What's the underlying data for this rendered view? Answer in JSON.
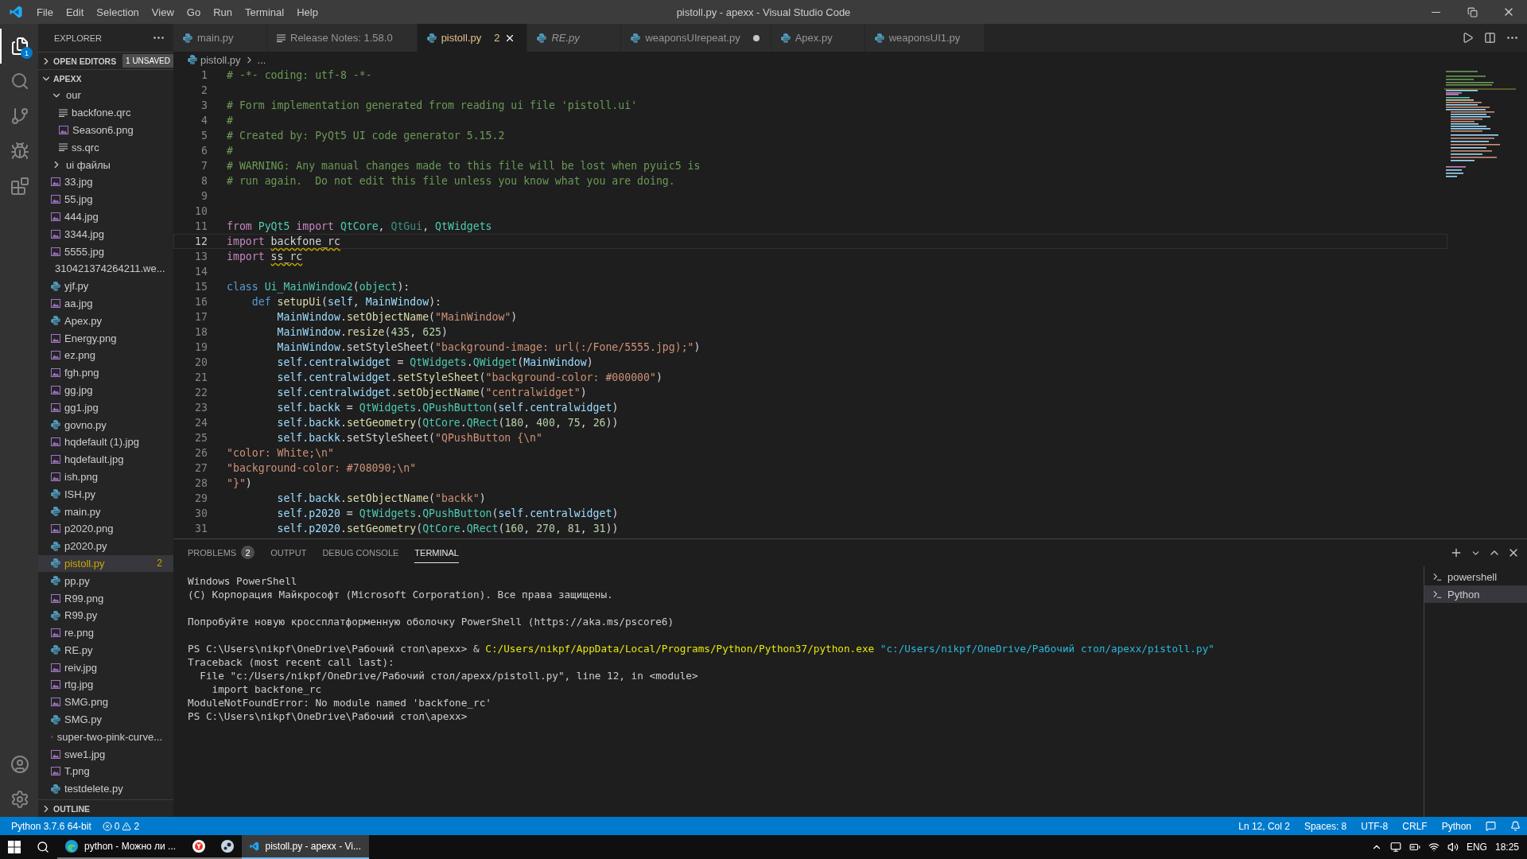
{
  "title_bar": {
    "menus": [
      "File",
      "Edit",
      "Selection",
      "View",
      "Go",
      "Run",
      "Terminal",
      "Help"
    ],
    "title": "pistoll.py - apexx - Visual Studio Code"
  },
  "activity_bar": {
    "explorer_badge": "1"
  },
  "explorer": {
    "title": "EXPLORER",
    "open_editors": {
      "label": "OPEN EDITORS",
      "badge": "1 UNSAVED",
      "expanded": false
    },
    "root": {
      "label": "APEXX",
      "expanded": true,
      "children": [
        {
          "label": "our",
          "kind": "folder",
          "expanded": true,
          "selected": false,
          "children": [
            {
              "label": "backfone.qrc",
              "kind": "resource",
              "selected": false
            },
            {
              "label": "Season6.png",
              "kind": "image",
              "selected": false
            },
            {
              "label": "ss.qrc",
              "kind": "resource",
              "selected": false
            }
          ]
        },
        {
          "label": "ui файлы",
          "kind": "folder",
          "expanded": false,
          "selected": false
        },
        {
          "label": "33.jpg",
          "kind": "image",
          "selected": false
        },
        {
          "label": "55.jpg",
          "kind": "image",
          "selected": false
        },
        {
          "label": "444.jpg",
          "kind": "image",
          "selected": false
        },
        {
          "label": "3344.jpg",
          "kind": "image",
          "selected": false
        },
        {
          "label": "5555.jpg",
          "kind": "image",
          "selected": false
        },
        {
          "label": "310421374264211.we...",
          "kind": "image",
          "selected": false
        },
        {
          "label": "yjf.py",
          "kind": "python",
          "selected": false
        },
        {
          "label": "aa.jpg",
          "kind": "image",
          "selected": false
        },
        {
          "label": "Apex.py",
          "kind": "python",
          "selected": false
        },
        {
          "label": "Energy.png",
          "kind": "image",
          "selected": false
        },
        {
          "label": "ez.png",
          "kind": "image",
          "selected": false
        },
        {
          "label": "fgh.png",
          "kind": "image",
          "selected": false
        },
        {
          "label": "gg.jpg",
          "kind": "image",
          "selected": false
        },
        {
          "label": "gg1.jpg",
          "kind": "image",
          "selected": false
        },
        {
          "label": "govno.py",
          "kind": "python",
          "selected": false
        },
        {
          "label": "hqdefault (1).jpg",
          "kind": "image",
          "selected": false
        },
        {
          "label": "hqdefault.jpg",
          "kind": "image",
          "selected": false
        },
        {
          "label": "ish.png",
          "kind": "image",
          "selected": false
        },
        {
          "label": "ISH.py",
          "kind": "python",
          "selected": false
        },
        {
          "label": "main.py",
          "kind": "python",
          "selected": false
        },
        {
          "label": "p2020.png",
          "kind": "image",
          "selected": false
        },
        {
          "label": "p2020.py",
          "kind": "python",
          "selected": false
        },
        {
          "label": "pistoll.py",
          "kind": "python",
          "selected": true,
          "badge": "2"
        },
        {
          "label": "pp.py",
          "kind": "python",
          "selected": false
        },
        {
          "label": "R99.png",
          "kind": "image",
          "selected": false
        },
        {
          "label": "R99.py",
          "kind": "python",
          "selected": false
        },
        {
          "label": "re.png",
          "kind": "image",
          "selected": false
        },
        {
          "label": "RE.py",
          "kind": "python",
          "selected": false
        },
        {
          "label": "reiv.jpg",
          "kind": "image",
          "selected": false
        },
        {
          "label": "rtg.jpg",
          "kind": "image",
          "selected": false
        },
        {
          "label": "SMG.png",
          "kind": "image",
          "selected": false
        },
        {
          "label": "SMG.py",
          "kind": "python",
          "selected": false
        },
        {
          "label": "super-two-pink-curve...",
          "kind": "image",
          "selected": false
        },
        {
          "label": "swe1.jpg",
          "kind": "image",
          "selected": false
        },
        {
          "label": "T.png",
          "kind": "image",
          "selected": false
        },
        {
          "label": "testdelete.py",
          "kind": "python",
          "selected": false
        }
      ]
    },
    "outline": {
      "label": "OUTLINE",
      "expanded": false
    }
  },
  "tabs": [
    {
      "label": "main.py",
      "kind": "python",
      "selected": false,
      "preview": false,
      "dirty": false
    },
    {
      "label": "Release Notes: 1.58.0",
      "kind": "notes",
      "selected": false,
      "preview": false,
      "dirty": false
    },
    {
      "label": "pistoll.py",
      "kind": "python",
      "selected": true,
      "preview": false,
      "dirty": false,
      "badge": "2"
    },
    {
      "label": "RE.py",
      "kind": "python",
      "selected": false,
      "preview": true,
      "dirty": false
    },
    {
      "label": "weaponsUIrepeat.py",
      "kind": "python",
      "selected": false,
      "preview": false,
      "dirty": true
    },
    {
      "label": "Apex.py",
      "kind": "python",
      "selected": false,
      "preview": false,
      "dirty": false
    },
    {
      "label": "weaponsUI1.py",
      "kind": "python",
      "selected": false,
      "preview": false,
      "dirty": false
    }
  ],
  "breadcrumbs": [
    "pistoll.py",
    "..."
  ],
  "code": [
    {
      "number": "1",
      "current": false,
      "tokens": [
        {
          "kind": "cm",
          "text": "# -*- coding: utf-8 -*-"
        }
      ]
    },
    {
      "number": "2",
      "current": false
    },
    {
      "number": "3",
      "current": false,
      "tokens": [
        {
          "kind": "cm",
          "text": "# Form implementation generated from reading ui file 'pistoll.ui'"
        }
      ]
    },
    {
      "number": "4",
      "current": false,
      "tokens": [
        {
          "kind": "cm",
          "text": "#"
        }
      ]
    },
    {
      "number": "5",
      "current": false,
      "tokens": [
        {
          "kind": "cm",
          "text": "# Created by: PyQt5 UI code generator 5.15.2"
        }
      ]
    },
    {
      "number": "6",
      "current": false,
      "tokens": [
        {
          "kind": "cm",
          "text": "#"
        }
      ]
    },
    {
      "number": "7",
      "current": false,
      "tokens": [
        {
          "kind": "cm",
          "text": "# WARNING: Any manual changes made to this file will be lost when pyuic5 is"
        }
      ]
    },
    {
      "number": "8",
      "current": false,
      "tokens": [
        {
          "kind": "cm",
          "text": "# run again.  Do not edit this file unless you know what you are doing."
        }
      ]
    },
    {
      "number": "9",
      "current": false
    },
    {
      "number": "10",
      "current": false
    },
    {
      "number": "11",
      "current": false,
      "tokens": [
        {
          "kind": "kw",
          "text": "from "
        },
        {
          "kind": "cls",
          "text": "PyQt5"
        },
        {
          "kind": "kw",
          "text": " import "
        },
        {
          "kind": "cls",
          "text": "QtCore"
        },
        {
          "kind": "tx",
          "text": ", "
        },
        {
          "kind": "dim",
          "text": "QtGui"
        },
        {
          "kind": "tx",
          "text": ", "
        },
        {
          "kind": "cls",
          "text": "QtWidgets"
        }
      ]
    },
    {
      "number": "12",
      "current": true,
      "tokens": [
        {
          "kind": "kw",
          "text": "import "
        },
        {
          "kind": "warn",
          "text": "backfone_rc"
        }
      ]
    },
    {
      "number": "13",
      "current": false,
      "tokens": [
        {
          "kind": "kw",
          "text": "import "
        },
        {
          "kind": "warn",
          "text": "ss_rc"
        }
      ]
    },
    {
      "number": "14",
      "current": false
    },
    {
      "number": "15",
      "current": false,
      "tokens": [
        {
          "kind": "st",
          "text": "class "
        },
        {
          "kind": "cls",
          "text": "Ui_MainWindow2"
        },
        {
          "kind": "tx",
          "text": "("
        },
        {
          "kind": "cls",
          "text": "object"
        },
        {
          "kind": "tx",
          "text": "):"
        }
      ]
    },
    {
      "number": "16",
      "current": false,
      "tokens": [
        {
          "kind": "st",
          "text": "    def "
        },
        {
          "kind": "fn",
          "text": "setupUi"
        },
        {
          "kind": "tx",
          "text": "("
        },
        {
          "kind": "var",
          "text": "self"
        },
        {
          "kind": "tx",
          "text": ", "
        },
        {
          "kind": "var",
          "text": "MainWindow"
        },
        {
          "kind": "tx",
          "text": "):"
        }
      ]
    },
    {
      "number": "17",
      "current": false,
      "tokens": [
        {
          "kind": "var",
          "text": "        MainWindow"
        },
        {
          "kind": "tx",
          "text": "."
        },
        {
          "kind": "fn",
          "text": "setObjectName"
        },
        {
          "kind": "tx",
          "text": "("
        },
        {
          "kind": "str",
          "text": "\"MainWindow\""
        },
        {
          "kind": "tx",
          "text": ")"
        }
      ]
    },
    {
      "number": "18",
      "current": false,
      "tokens": [
        {
          "kind": "var",
          "text": "        MainWindow"
        },
        {
          "kind": "tx",
          "text": "."
        },
        {
          "kind": "fn",
          "text": "resize"
        },
        {
          "kind": "tx",
          "text": "("
        },
        {
          "kind": "num",
          "text": "435"
        },
        {
          "kind": "tx",
          "text": ", "
        },
        {
          "kind": "num",
          "text": "625"
        },
        {
          "kind": "tx",
          "text": ")"
        }
      ]
    },
    {
      "number": "19",
      "current": false,
      "tokens": [
        {
          "kind": "var",
          "text": "        MainWindow"
        },
        {
          "kind": "tx",
          "text": ".setStyleSheet("
        },
        {
          "kind": "str",
          "text": "\"background-image: url(:/Fone/5555.jpg);\""
        },
        {
          "kind": "tx",
          "text": ")"
        }
      ]
    },
    {
      "number": "20",
      "current": false,
      "tokens": [
        {
          "kind": "var",
          "text": "        self.centralwidget"
        },
        {
          "kind": "tx",
          "text": " = "
        },
        {
          "kind": "cls",
          "text": "QtWidgets"
        },
        {
          "kind": "tx",
          "text": "."
        },
        {
          "kind": "cls",
          "text": "QWidget"
        },
        {
          "kind": "tx",
          "text": "("
        },
        {
          "kind": "var",
          "text": "MainWindow"
        },
        {
          "kind": "tx",
          "text": ")"
        }
      ]
    },
    {
      "number": "21",
      "current": false,
      "tokens": [
        {
          "kind": "var",
          "text": "        self.centralwidget"
        },
        {
          "kind": "tx",
          "text": "."
        },
        {
          "kind": "fn",
          "text": "setStyleSheet"
        },
        {
          "kind": "tx",
          "text": "("
        },
        {
          "kind": "str",
          "text": "\"background-color: #000000\""
        },
        {
          "kind": "tx",
          "text": ")"
        }
      ]
    },
    {
      "number": "22",
      "current": false,
      "tokens": [
        {
          "kind": "var",
          "text": "        self.centralwidget"
        },
        {
          "kind": "tx",
          "text": "."
        },
        {
          "kind": "fn",
          "text": "setObjectName"
        },
        {
          "kind": "tx",
          "text": "("
        },
        {
          "kind": "str",
          "text": "\"centralwidget\""
        },
        {
          "kind": "tx",
          "text": ")"
        }
      ]
    },
    {
      "number": "23",
      "current": false,
      "tokens": [
        {
          "kind": "var",
          "text": "        self.backk"
        },
        {
          "kind": "tx",
          "text": " = "
        },
        {
          "kind": "cls",
          "text": "QtWidgets"
        },
        {
          "kind": "tx",
          "text": "."
        },
        {
          "kind": "cls",
          "text": "QPushButton"
        },
        {
          "kind": "tx",
          "text": "("
        },
        {
          "kind": "var",
          "text": "self.centralwidget"
        },
        {
          "kind": "tx",
          "text": ")"
        }
      ]
    },
    {
      "number": "24",
      "current": false,
      "tokens": [
        {
          "kind": "var",
          "text": "        self.backk"
        },
        {
          "kind": "tx",
          "text": "."
        },
        {
          "kind": "fn",
          "text": "setGeometry"
        },
        {
          "kind": "tx",
          "text": "("
        },
        {
          "kind": "cls",
          "text": "QtCore"
        },
        {
          "kind": "tx",
          "text": "."
        },
        {
          "kind": "cls",
          "text": "QRect"
        },
        {
          "kind": "tx",
          "text": "("
        },
        {
          "kind": "num",
          "text": "180"
        },
        {
          "kind": "tx",
          "text": ", "
        },
        {
          "kind": "num",
          "text": "400"
        },
        {
          "kind": "tx",
          "text": ", "
        },
        {
          "kind": "num",
          "text": "75"
        },
        {
          "kind": "tx",
          "text": ", "
        },
        {
          "kind": "num",
          "text": "26"
        },
        {
          "kind": "tx",
          "text": "))"
        }
      ]
    },
    {
      "number": "25",
      "current": false,
      "tokens": [
        {
          "kind": "var",
          "text": "        self.backk"
        },
        {
          "kind": "tx",
          "text": ".setStyleSheet("
        },
        {
          "kind": "str",
          "text": "\"QPushButton {\\n\""
        }
      ]
    },
    {
      "number": "26",
      "current": false,
      "tokens": [
        {
          "kind": "str",
          "text": "\"color: White;\\n\""
        }
      ]
    },
    {
      "number": "27",
      "current": false,
      "tokens": [
        {
          "kind": "str",
          "text": "\"background-color: #708090;\\n\""
        }
      ]
    },
    {
      "number": "28",
      "current": false,
      "tokens": [
        {
          "kind": "str",
          "text": "\"}\""
        },
        {
          "kind": "tx",
          "text": ")"
        }
      ]
    },
    {
      "number": "29",
      "current": false,
      "tokens": [
        {
          "kind": "var",
          "text": "        self.backk"
        },
        {
          "kind": "tx",
          "text": "."
        },
        {
          "kind": "fn",
          "text": "setObjectName"
        },
        {
          "kind": "tx",
          "text": "("
        },
        {
          "kind": "str",
          "text": "\"backk\""
        },
        {
          "kind": "tx",
          "text": ")"
        }
      ]
    },
    {
      "number": "30",
      "current": false,
      "tokens": [
        {
          "kind": "var",
          "text": "        self.p2020"
        },
        {
          "kind": "tx",
          "text": " = "
        },
        {
          "kind": "cls",
          "text": "QtWidgets"
        },
        {
          "kind": "tx",
          "text": "."
        },
        {
          "kind": "cls",
          "text": "QPushButton"
        },
        {
          "kind": "tx",
          "text": "("
        },
        {
          "kind": "var",
          "text": "self.centralwidget"
        },
        {
          "kind": "tx",
          "text": ")"
        }
      ]
    },
    {
      "number": "31",
      "current": false,
      "tokens": [
        {
          "kind": "var",
          "text": "        self.p2020"
        },
        {
          "kind": "tx",
          "text": "."
        },
        {
          "kind": "fn",
          "text": "setGeometry"
        },
        {
          "kind": "tx",
          "text": "("
        },
        {
          "kind": "cls",
          "text": "QtCore"
        },
        {
          "kind": "tx",
          "text": "."
        },
        {
          "kind": "cls",
          "text": "QRect"
        },
        {
          "kind": "tx",
          "text": "("
        },
        {
          "kind": "num",
          "text": "160"
        },
        {
          "kind": "tx",
          "text": ", "
        },
        {
          "kind": "num",
          "text": "270"
        },
        {
          "kind": "tx",
          "text": ", "
        },
        {
          "kind": "num",
          "text": "81"
        },
        {
          "kind": "tx",
          "text": ", "
        },
        {
          "kind": "num",
          "text": "31"
        },
        {
          "kind": "tx",
          "text": "))"
        }
      ]
    }
  ],
  "panel": {
    "tabs": [
      {
        "label": "PROBLEMS",
        "selected": false,
        "badge": "2"
      },
      {
        "label": "OUTPUT",
        "selected": false
      },
      {
        "label": "DEBUG CONSOLE",
        "selected": false
      },
      {
        "label": "TERMINAL",
        "selected": true
      }
    ],
    "terminal": [
      {
        "kind": "text",
        "segments": [
          {
            "kind": "plain",
            "text": "Windows PowerShell"
          }
        ]
      },
      {
        "kind": "text",
        "segments": [
          {
            "kind": "plain",
            "text": "(C) Корпорация Майкрософт (Microsoft Corporation). Все права защищены."
          }
        ]
      },
      {
        "kind": "blank"
      },
      {
        "kind": "text",
        "segments": [
          {
            "kind": "plain",
            "text": "Попробуйте новую кроссплатформенную оболочку PowerShell (https://aka.ms/pscore6)"
          }
        ]
      },
      {
        "kind": "blank"
      },
      {
        "kind": "text",
        "segments": [
          {
            "kind": "plain",
            "text": "PS C:\\Users\\nikpf\\OneDrive\\Рабочий стол\\apexx> & "
          },
          {
            "kind": "path",
            "text": "C:/Users/nikpf/AppData/Local/Programs/Python/Python37/python.exe"
          },
          {
            "kind": "string",
            "text": " \"c:/Users/nikpf/OneDrive/Рабочий стол/apexx/pistoll.py\""
          }
        ]
      },
      {
        "kind": "text",
        "segments": [
          {
            "kind": "plain",
            "text": "Traceback (most recent call last):"
          }
        ]
      },
      {
        "kind": "text",
        "segments": [
          {
            "kind": "plain",
            "text": "  File \"c:/Users/nikpf/OneDrive/Рабочий стол/apexx/pistoll.py\", line 12, in <module>"
          }
        ]
      },
      {
        "kind": "text",
        "segments": [
          {
            "kind": "plain",
            "text": "    import backfone_rc"
          }
        ]
      },
      {
        "kind": "text",
        "segments": [
          {
            "kind": "plain",
            "text": "ModuleNotFoundError: No module named 'backfone_rc'"
          }
        ]
      },
      {
        "kind": "text",
        "segments": [
          {
            "kind": "plain",
            "text": "PS C:\\Users\\nikpf\\OneDrive\\Рабочий стол\\apexx>"
          }
        ]
      }
    ],
    "shells": [
      {
        "label": "powershell",
        "selected": false
      },
      {
        "label": "Python",
        "selected": true
      }
    ]
  },
  "status_bar": {
    "interpreter": "Python 3.7.6 64-bit",
    "errors": "0",
    "warnings": "2",
    "right": [
      "Ln 12, Col 2",
      "Spaces: 8",
      "UTF-8",
      "CRLF",
      "Python"
    ]
  },
  "taskbar": {
    "apps": [
      {
        "kind": "browser",
        "label": "python - Можно ли ...",
        "active": false
      },
      {
        "kind": "yandex",
        "active": false
      },
      {
        "kind": "steam",
        "active": false
      },
      {
        "kind": "vscode",
        "label": "pistoll.py - apexx - Vi...",
        "active": true
      }
    ],
    "language": "ENG",
    "time": "18:25"
  }
}
